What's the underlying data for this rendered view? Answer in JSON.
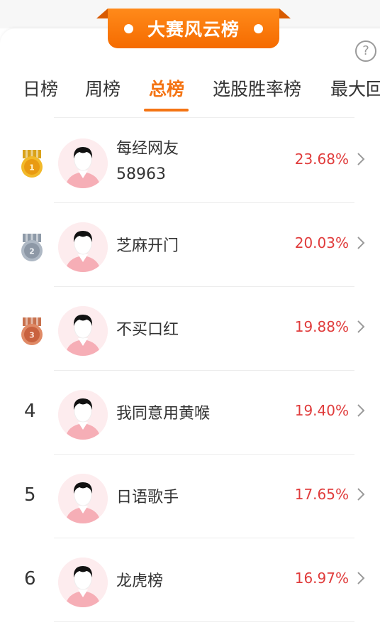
{
  "header": {
    "title": "大赛风云榜",
    "help_symbol": "?"
  },
  "tabs": [
    {
      "label": "日榜",
      "active": false
    },
    {
      "label": "周榜",
      "active": false
    },
    {
      "label": "总榜",
      "active": true
    },
    {
      "label": "选股胜率榜",
      "active": false
    },
    {
      "label": "最大回",
      "active": false
    }
  ],
  "leaderboard": [
    {
      "rank": "1",
      "medal": "gold",
      "name": "每经网友",
      "name2": "58963",
      "rate": "23.68%"
    },
    {
      "rank": "2",
      "medal": "silver",
      "name": "芝麻开门",
      "name2": "",
      "rate": "20.03%"
    },
    {
      "rank": "3",
      "medal": "bronze",
      "name": "不买口红",
      "name2": "",
      "rate": "19.88%"
    },
    {
      "rank": "4",
      "medal": "",
      "name": "我同意用黄喉",
      "name2": "",
      "rate": "19.40%"
    },
    {
      "rank": "5",
      "medal": "",
      "name": "日语歌手",
      "name2": "",
      "rate": "17.65%"
    },
    {
      "rank": "6",
      "medal": "",
      "name": "龙虎榜",
      "name2": "",
      "rate": "16.97%"
    }
  ],
  "colors": {
    "accent": "#f47414",
    "rate": "#e03b3b"
  }
}
